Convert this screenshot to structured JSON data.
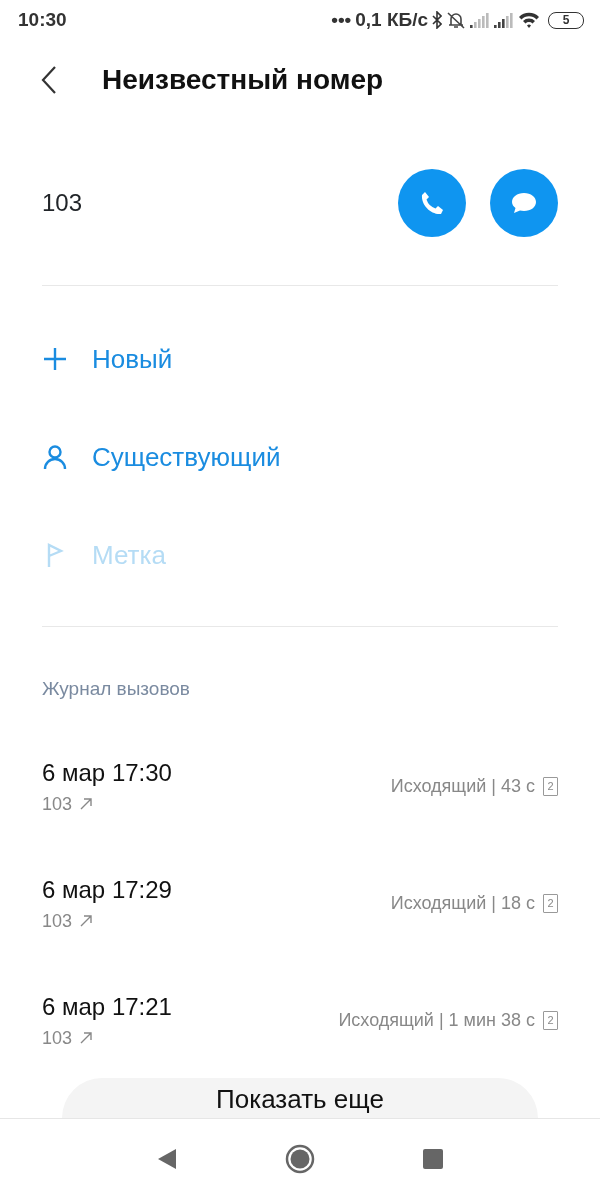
{
  "status_bar": {
    "time": "10:30",
    "dots": "•••",
    "speed": "0,1 КБ/с",
    "battery": "5"
  },
  "header": {
    "title": "Неизвестный номер"
  },
  "contact": {
    "number": "103"
  },
  "actions": [
    {
      "kind": "add",
      "label": "Новый",
      "disabled": false
    },
    {
      "kind": "person",
      "label": "Существующий",
      "disabled": false
    },
    {
      "kind": "flag",
      "label": "Метка",
      "disabled": true
    }
  ],
  "call_log": {
    "title": "Журнал вызовов",
    "entries": [
      {
        "datetime": "6 мар 17:30",
        "number": "103",
        "info": "Исходящий | 43 с",
        "sim": "2"
      },
      {
        "datetime": "6 мар 17:29",
        "number": "103",
        "info": "Исходящий | 18 с",
        "sim": "2"
      },
      {
        "datetime": "6 мар 17:21",
        "number": "103",
        "info": "Исходящий | 1 мин 38 с",
        "sim": "2"
      }
    ]
  },
  "show_more": {
    "label": "Показать еще"
  }
}
